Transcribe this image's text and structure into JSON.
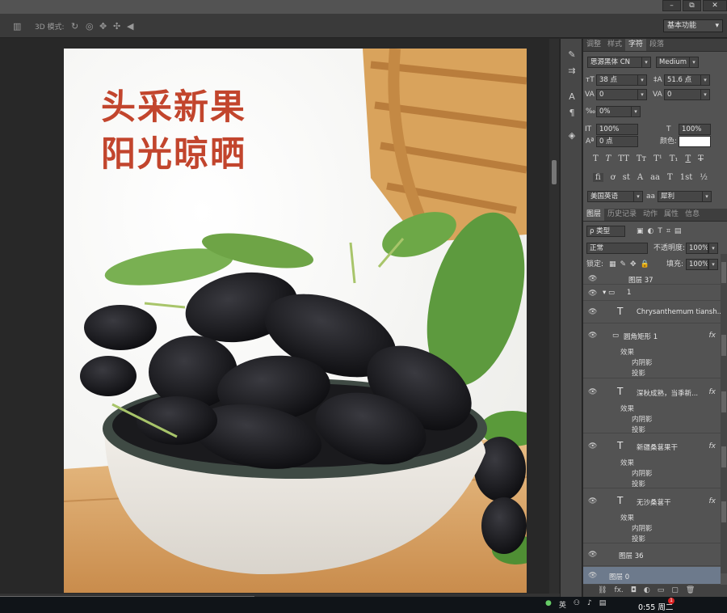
{
  "titlebar": {
    "min": "–",
    "restore": "⧉",
    "close": "✕"
  },
  "options_bar": {
    "mode_label": "3D 模式:",
    "workspace": "基本功能"
  },
  "document": {
    "headline_line1": "头采新果",
    "headline_line2": "阳光晾晒"
  },
  "character_panel": {
    "tabs": [
      "调整",
      "样式",
      "字符",
      "段落"
    ],
    "active_tab": "字符",
    "font_family": "思源黑体 CN",
    "font_style": "Medium",
    "font_size": "38 点",
    "leading": "51.6 点",
    "kerning": "0",
    "tracking": "0",
    "tsume": "0%",
    "vertical_scale": "100%",
    "horizontal_scale": "100%",
    "baseline_shift": "0 点",
    "color_label": "颜色:",
    "color_value": "#ffffff",
    "language": "美国英语",
    "aa_label": "aa",
    "antialias": "犀利"
  },
  "layers_panel": {
    "tabs": [
      "图层",
      "历史记录",
      "动作",
      "属性",
      "信息"
    ],
    "active_tab": "图层",
    "filter": "ρ 类型",
    "blend_mode": "正常",
    "opacity_label": "不透明度:",
    "opacity": "100%",
    "lock_label": "锁定:",
    "fill_label": "填充:",
    "fill": "100%",
    "layers": [
      {
        "name": "图层 37"
      },
      {
        "name": "1"
      },
      {
        "name": "Chrysanthemum tiansh..."
      },
      {
        "name": "圆角矩形 1",
        "effects": "效果",
        "e1": "内阴影",
        "e2": "投影"
      },
      {
        "name": "深秋成熟，当季新...",
        "effects": "效果",
        "e1": "内阴影",
        "e2": "投影"
      },
      {
        "name": "新疆桑葚果干",
        "effects": "效果",
        "e1": "内阴影",
        "e2": "投影"
      },
      {
        "name": "无沙桑葚干",
        "effects": "效果",
        "e1": "内阴影",
        "e2": "投影"
      },
      {
        "name": "图层 36"
      },
      {
        "name": "图层 0"
      }
    ]
  },
  "taskbar": {
    "ime": "英",
    "time": "0:55 周二",
    "badge": "1"
  }
}
